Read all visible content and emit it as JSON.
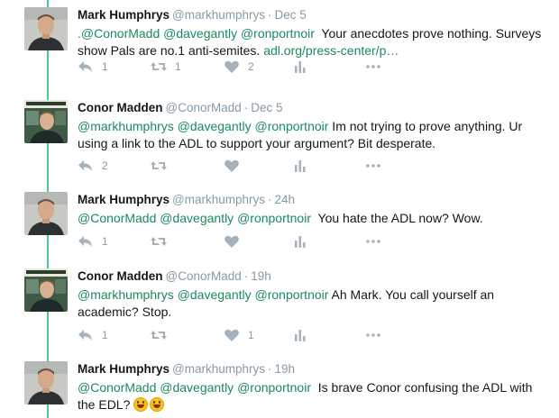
{
  "colors": {
    "thread": "#4ec88f",
    "link": "#1b8a5a",
    "muted": "#8899a6",
    "icon": "#a6b2bb"
  },
  "tweets": [
    {
      "name": "Mark Humphrys",
      "handle": "@markhumphrys",
      "time": "Dec 5",
      "pre": ".",
      "mentions": "@ConorMadd @davegantly @ronportnoir",
      "body": "  Your anecdotes prove nothing. Surveys show Pals are no.1 anti-semites. ",
      "link": "adl.org/press-center/p…",
      "reply_count": "1",
      "retweet_count": "1",
      "like_count": "2",
      "avatar": "mark-photo"
    },
    {
      "name": "Conor Madden",
      "handle": "@ConorMadd",
      "time": "Dec 5",
      "mentions": "@markhumphrys @davegantly @ronportnoir",
      "body": " Im not trying to prove anything. Ur using a link to the ADL to support your argument? Bit desperate.",
      "reply_count": "2",
      "retweet_count": "",
      "like_count": "",
      "avatar": "conor-photo"
    },
    {
      "name": "Mark Humphrys",
      "handle": "@markhumphrys",
      "time": "24h",
      "mentions": "@ConorMadd @davegantly @ronportnoir",
      "body": "  You hate the ADL now? Wow.",
      "reply_count": "1",
      "retweet_count": "",
      "like_count": "",
      "avatar": "mark-photo"
    },
    {
      "name": "Conor Madden",
      "handle": "@ConorMadd",
      "time": "19h",
      "mentions": "@markhumphrys @davegantly @ronportnoir",
      "body": " Ah Mark. You call yourself an academic? Stop.",
      "reply_count": "1",
      "retweet_count": "",
      "like_count": "1",
      "avatar": "conor-photo"
    },
    {
      "name": "Mark Humphrys",
      "handle": "@markhumphrys",
      "time": "19h",
      "mentions": "@ConorMadd @davegantly @ronportnoir",
      "body": "  Is brave Conor confusing the ADL with the EDL? ",
      "emojis": [
        "grinning-face",
        "grinning-face"
      ],
      "reply_count": "",
      "retweet_count": "",
      "like_count": "",
      "avatar": "mark-photo"
    }
  ],
  "icons": {
    "reply": "reply-icon",
    "retweet": "retweet-icon",
    "like": "heart-icon",
    "stats": "bar-chart-icon",
    "more": "more-icon"
  },
  "separator": "·"
}
